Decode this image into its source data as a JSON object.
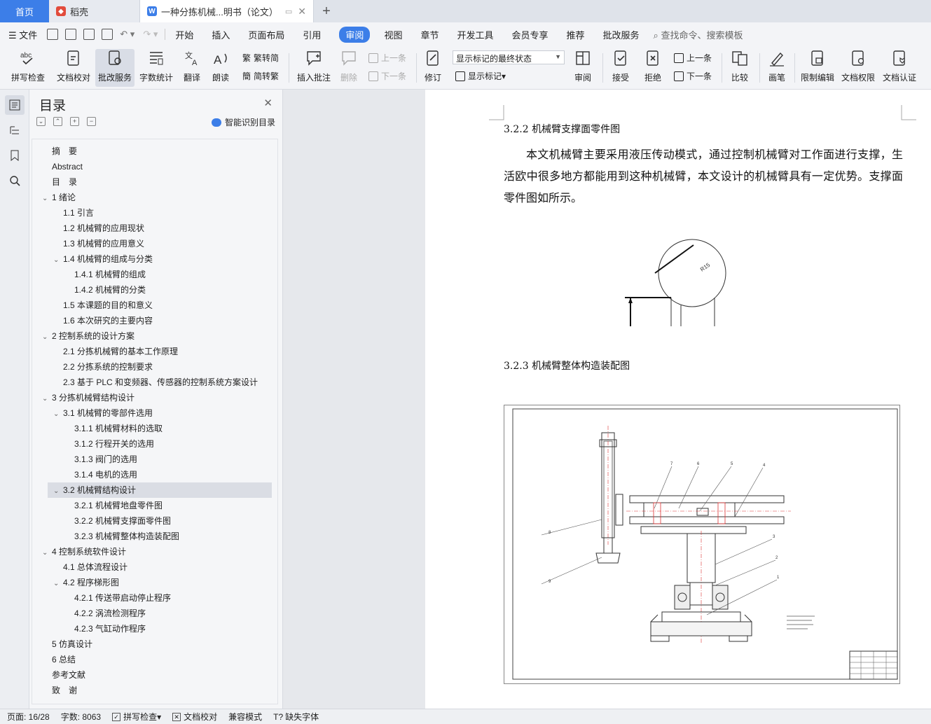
{
  "tabs": {
    "home": "首页",
    "daoke": "稻壳",
    "document": "一种分拣机械...明书（论文）"
  },
  "menu": {
    "file": "文件",
    "items": [
      "开始",
      "插入",
      "页面布局",
      "引用",
      "审阅",
      "视图",
      "章节",
      "开发工具",
      "会员专享",
      "推荐",
      "批改服务"
    ],
    "active": "审阅",
    "search": "查找命令、搜索模板"
  },
  "ribbon": {
    "spellcheck": "拼写检查",
    "proofread": "文档校对",
    "correction": "批改服务",
    "wordcount": "字数统计",
    "translate": "翻译",
    "read": "朗读",
    "trad": "繁转简",
    "simp": "简转繁",
    "insert_comment": "插入批注",
    "delete": "删除",
    "prev": "上一条",
    "next": "下一条",
    "revise": "修订",
    "markup_state": "显示标记的最终状态",
    "show_markup": "显示标记",
    "review": "审阅",
    "accept": "接受",
    "reject": "拒绝",
    "prev2": "上一条",
    "next2": "下一条",
    "compare": "比较",
    "pen": "画笔",
    "restrict": "限制编辑",
    "permission": "文档权限",
    "certify": "文档认证"
  },
  "toc": {
    "title": "目录",
    "smart": "智能识别目录",
    "items": [
      {
        "text": "摘　要",
        "level": 0,
        "chev": ""
      },
      {
        "text": "Abstract",
        "level": 0,
        "chev": ""
      },
      {
        "text": "目　录",
        "level": 0,
        "chev": ""
      },
      {
        "text": "1  绪论",
        "level": 0,
        "chev": "v"
      },
      {
        "text": "1.1 引言",
        "level": 1,
        "chev": ""
      },
      {
        "text": "1.2  机械臂的应用现状",
        "level": 1,
        "chev": ""
      },
      {
        "text": "1.3  机械臂的应用意义",
        "level": 1,
        "chev": ""
      },
      {
        "text": "1.4 机械臂的组成与分类",
        "level": 1,
        "chev": "v"
      },
      {
        "text": "1.4.1 机械臂的组成",
        "level": 2,
        "chev": ""
      },
      {
        "text": "1.4.2 机械臂的分类",
        "level": 2,
        "chev": ""
      },
      {
        "text": "1.5 本课题的目的和意义",
        "level": 1,
        "chev": ""
      },
      {
        "text": "1.6  本次研究的主要内容",
        "level": 1,
        "chev": ""
      },
      {
        "text": "2  控制系统的设计方案",
        "level": 0,
        "chev": "v"
      },
      {
        "text": "2.1 分拣机械臂的基本工作原理",
        "level": 1,
        "chev": ""
      },
      {
        "text": "2.2 分拣系统的控制要求",
        "level": 1,
        "chev": ""
      },
      {
        "text": "2.3 基于 PLC 和变频器、传感器的控制系统方案设计",
        "level": 1,
        "chev": ""
      },
      {
        "text": "3  分拣机械臂结构设计",
        "level": 0,
        "chev": "v"
      },
      {
        "text": "3.1 机械臂的零部件选用",
        "level": 1,
        "chev": "v"
      },
      {
        "text": "3.1.1 机械臂材料的选取",
        "level": 2,
        "chev": ""
      },
      {
        "text": "3.1.2 行程开关的选用",
        "level": 2,
        "chev": ""
      },
      {
        "text": "3.1.3  阀门的选用",
        "level": 2,
        "chev": ""
      },
      {
        "text": "3.1.4  电机的选用",
        "level": 2,
        "chev": ""
      },
      {
        "text": "3.2 机械臂结构设计",
        "level": 1,
        "chev": "v",
        "selected": true
      },
      {
        "text": "3.2.1 机械臂地盘零件图",
        "level": 2,
        "chev": ""
      },
      {
        "text": "3.2.2 机械臂支撑面零件图",
        "level": 2,
        "chev": ""
      },
      {
        "text": "3.2.3 机械臂整体构造装配图",
        "level": 2,
        "chev": ""
      },
      {
        "text": "4  控制系统软件设计",
        "level": 0,
        "chev": "v"
      },
      {
        "text": "4.1 总体流程设计",
        "level": 1,
        "chev": ""
      },
      {
        "text": "4.2 程序梯形图",
        "level": 1,
        "chev": "v"
      },
      {
        "text": "4.2.1 传送带启动停止程序",
        "level": 2,
        "chev": ""
      },
      {
        "text": "4.2.2 涡流检测程序",
        "level": 2,
        "chev": ""
      },
      {
        "text": "4.2.3 气缸动作程序",
        "level": 2,
        "chev": ""
      },
      {
        "text": "5  仿真设计",
        "level": 0,
        "chev": ""
      },
      {
        "text": "6  总结",
        "level": 0,
        "chev": ""
      },
      {
        "text": "参考文献",
        "level": 0,
        "chev": ""
      },
      {
        "text": "致　谢",
        "level": 0,
        "chev": ""
      }
    ]
  },
  "document": {
    "heading1": "3.2.2 机械臂支撑面零件图",
    "paragraph": "本文机械臂主要采用液压传动模式，通过控制机械臂对工作面进行支撑，生活欧中很多地方都能用到这种机械臂，本文设计的机械臂具有一定优势。支撑面零件图如所示。",
    "dim_label": "R15",
    "heading2": "3.2.3 机械臂整体构造装配图",
    "callouts": [
      "7",
      "6",
      "5",
      "4",
      "8",
      "3",
      "2",
      "1",
      "9"
    ]
  },
  "status": {
    "page": "页面: 16/28",
    "words": "字数: 8063",
    "spell": "拼写检查",
    "proof": "文档校对",
    "compat": "兼容模式",
    "font": "缺失字体"
  },
  "colors": {
    "accent": "#3c7ee8",
    "tab_bg": "#dfe3ea",
    "ribbon_bg": "#f3f4f7",
    "daoke_red": "#e24b3b"
  }
}
